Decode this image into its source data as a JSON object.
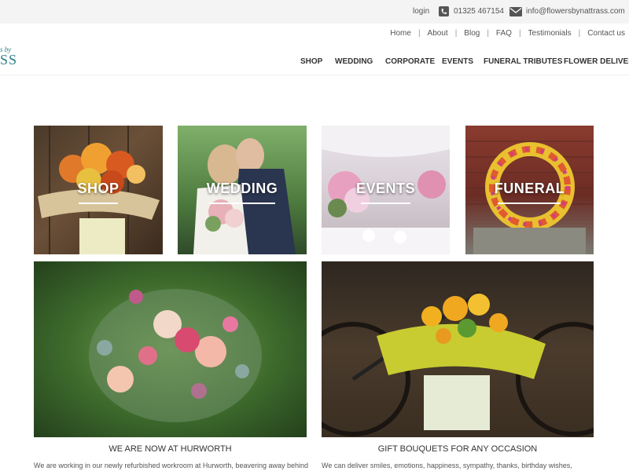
{
  "topbar": {
    "login": "login",
    "phone": "01325 467154",
    "email": "info@flowersbynattrass.com"
  },
  "secondary_nav": [
    "Home",
    "About",
    "Blog",
    "FAQ",
    "Testimonials",
    "Contact us"
  ],
  "logo": {
    "by": "s by",
    "main": "SS"
  },
  "main_nav": [
    "SHOP",
    "WEDDING",
    "CORPORATE",
    "EVENTS",
    "FUNERAL TRIBUTES",
    "FLOWER DELIVERY"
  ],
  "tiles": {
    "shop": "SHOP",
    "wedding": "WEDDING",
    "events": "EVENTS",
    "funeral": "FUNERAL"
  },
  "sections": {
    "left_title": "WE ARE NOW AT HURWORTH",
    "left_text": "We are working in our newly refurbished workroom at Hurworth, beavering away behind",
    "right_title": "GIFT BOUQUETS FOR ANY OCCASION",
    "right_text": "We can deliver smiles, emotions, happiness, sympathy, thanks, birthday wishes,"
  },
  "colors": {
    "brand": "#2c7f88",
    "topbar": "#f4f4f4"
  }
}
